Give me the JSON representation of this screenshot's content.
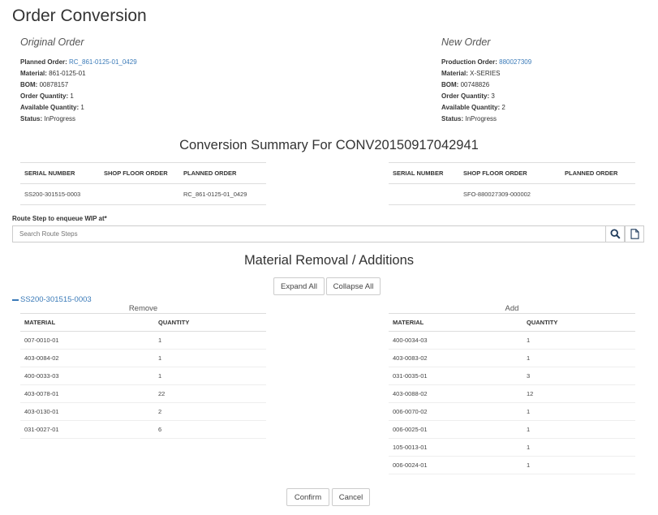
{
  "page": {
    "title": "Order Conversion"
  },
  "original_order": {
    "heading": "Original Order",
    "rows": [
      {
        "label": "Planned Order:",
        "value": "RC_861-0125-01_0429",
        "link": true
      },
      {
        "label": "Material:",
        "value": "861-0125-01",
        "link": false
      },
      {
        "label": "BOM:",
        "value": "00878157",
        "link": false
      },
      {
        "label": "Order Quantity:",
        "value": "1",
        "link": false
      },
      {
        "label": "Available Quantity:",
        "value": "1",
        "link": false
      },
      {
        "label": "Status:",
        "value": "InProgress",
        "link": false
      }
    ]
  },
  "new_order": {
    "heading": "New Order",
    "rows": [
      {
        "label": "Production Order:",
        "value": "880027309",
        "link": true
      },
      {
        "label": "Material:",
        "value": "X-SERIES",
        "link": false
      },
      {
        "label": "BOM:",
        "value": "00748826",
        "link": false
      },
      {
        "label": "Order Quantity:",
        "value": "3",
        "link": false
      },
      {
        "label": "Available Quantity:",
        "value": "2",
        "link": false
      },
      {
        "label": "Status:",
        "value": "InProgress",
        "link": false
      }
    ]
  },
  "summary": {
    "title": "Conversion Summary For CONV20150917042941",
    "columns": [
      "SERIAL NUMBER",
      "SHOP FLOOR ORDER",
      "PLANNED ORDER"
    ],
    "left_rows": [
      [
        "SS200-301515-0003",
        "",
        "RC_861-0125-01_0429"
      ]
    ],
    "right_rows": [
      [
        "",
        "SFO-880027309-000002",
        ""
      ]
    ]
  },
  "route": {
    "label": "Route Step to enqueue WIP at*",
    "placeholder": "Search Route Steps",
    "search_icon": "search-icon",
    "doc_icon": "document-icon"
  },
  "materials": {
    "title": "Material Removal / Additions",
    "expand_label": "Expand All",
    "collapse_label": "Collapse All",
    "serial": "SS200-301515-0003",
    "remove_label": "Remove",
    "add_label": "Add",
    "columns": [
      "MATERIAL",
      "QUANTITY"
    ],
    "remove_rows": [
      [
        "007-0010-01",
        "1"
      ],
      [
        "403-0084-02",
        "1"
      ],
      [
        "400-0033-03",
        "1"
      ],
      [
        "403-0078-01",
        "22"
      ],
      [
        "403-0130-01",
        "2"
      ],
      [
        "031-0027-01",
        "6"
      ]
    ],
    "add_rows": [
      [
        "400-0034-03",
        "1"
      ],
      [
        "403-0083-02",
        "1"
      ],
      [
        "031-0035-01",
        "3"
      ],
      [
        "403-0088-02",
        "12"
      ],
      [
        "006-0070-02",
        "1"
      ],
      [
        "006-0025-01",
        "1"
      ],
      [
        "105-0013-01",
        "1"
      ],
      [
        "006-0024-01",
        "1"
      ]
    ]
  },
  "footer": {
    "confirm_label": "Confirm",
    "cancel_label": "Cancel"
  },
  "colors": {
    "link": "#3a7ab8",
    "border": "#cccccc"
  }
}
